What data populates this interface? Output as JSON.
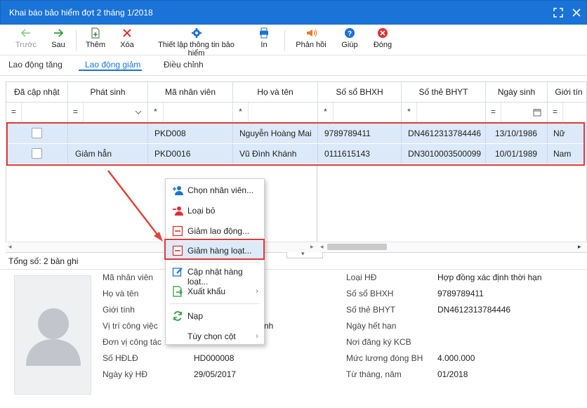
{
  "window": {
    "title": "Khai báo bảo hiểm đợt 2 tháng 1/2018"
  },
  "toolbar": {
    "prev": "Trước",
    "next": "Sau",
    "add": "Thêm",
    "delete": "Xóa",
    "settings": "Thiết lập thông tin bảo hiểm",
    "print": "In",
    "feedback": "Phản hồi",
    "help": "Giúp",
    "close": "Đóng"
  },
  "tabs": [
    "Lao động tăng",
    "Lao động giảm",
    "Điều chỉnh"
  ],
  "table": {
    "headers": [
      "Đã cập nhật",
      "Phát sinh",
      "Mã nhân viên",
      "Họ và tên",
      "Số sổ BHXH",
      "Số thẻ BHYT",
      "Ngày sinh",
      "Giới tín"
    ],
    "filter_ops": [
      "=",
      "=",
      "*",
      "*",
      "*",
      "*",
      "=",
      "="
    ],
    "rows": [
      {
        "phat_sinh": "",
        "ma_nv": "PKD008",
        "ho_ten": "Nguyễn Hoàng Mai",
        "so_bhxh": "9789789411",
        "so_bhyt": "DN4612313784446",
        "ngay_sinh": "13/10/1986",
        "gioi_tinh": "Nữ"
      },
      {
        "phat_sinh": "Giảm hẳn",
        "ma_nv": "PKD0016",
        "ho_ten": "Vũ Đình Khánh",
        "so_bhxh": "0111615143",
        "so_bhyt": "DN3010003500099",
        "ngay_sinh": "10/01/1989",
        "gioi_tinh": "Nam"
      }
    ]
  },
  "status": {
    "total": "Tổng số: 2 bản ghi"
  },
  "details": {
    "left_labels": [
      "Mã nhân viên",
      "Họ và tên",
      "Giới tính",
      "Vị trí công việc",
      "Đơn vị công tác",
      "Số HĐLĐ",
      "Ngày ký HĐ"
    ],
    "left_values": [
      "",
      "",
      "",
      "nh",
      "",
      "HD000008",
      "29/05/2017"
    ],
    "right_labels": [
      "Loại HĐ",
      "Số sổ BHXH",
      "Số thẻ BHYT",
      "Ngày hết hạn",
      "Nơi đăng ký KCB",
      "Mức lương đóng BH",
      "Từ tháng, năm"
    ],
    "right_values": [
      "Hợp đồng xác định thời hạn",
      "9789789411",
      "DN4612313784446",
      "",
      "",
      "4.000.000",
      "01/2018"
    ]
  },
  "context_menu": {
    "items": [
      "Chọn nhân viên...",
      "Loại bỏ",
      "Giảm lao động...",
      "Giảm hàng loạt...",
      "Cập nhật hàng loạt...",
      "Xuất khẩu",
      "Nạp",
      "Tùy chọn cột"
    ],
    "highlighted": "Giảm hàng loạt..."
  },
  "colors": {
    "accent": "#1a73d6",
    "highlight": "#e23a3a",
    "row_selected": "#dbe9f9"
  }
}
